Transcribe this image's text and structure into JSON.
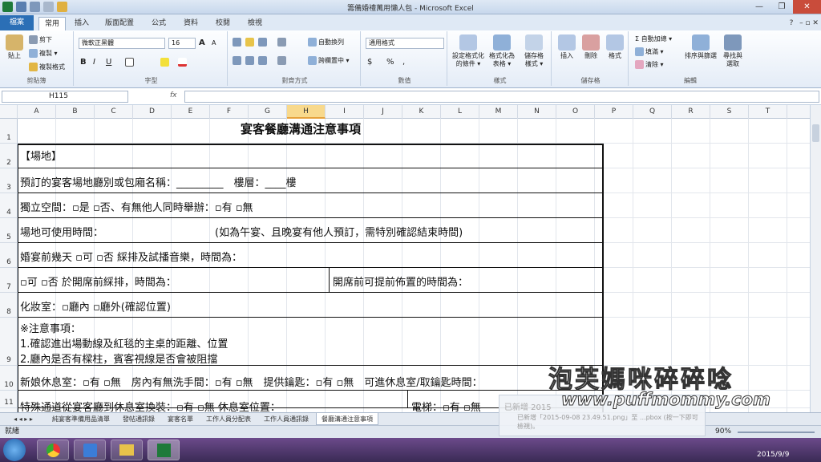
{
  "window": {
    "title": "籌備婚禮萬用懶人包 - Microsoft Excel"
  },
  "ribbon_tabs": {
    "file": "檔案",
    "home": "常用",
    "insert": "插入",
    "layout": "版面配置",
    "formulas": "公式",
    "data": "資料",
    "review": "校閱",
    "view": "檢視"
  },
  "clipboard": {
    "paste": "貼上",
    "cut": "剪下",
    "copy": "複製 ▾",
    "format_painter": "複製格式",
    "label": "剪貼簿"
  },
  "font": {
    "name": "微軟正黑體",
    "size": "16",
    "bold": "B",
    "italic": "I",
    "underline": "U",
    "grow": "A",
    "shrink": "A",
    "label": "字型"
  },
  "alignment": {
    "wrap": "自動換列",
    "merge": "跨欄置中 ▾",
    "label": "對齊方式"
  },
  "number": {
    "format": "通用格式",
    "currency": "$",
    "percent": "%",
    "comma": ",",
    "label": "數值"
  },
  "styles": {
    "conditional": "設定格式化\n的條件 ▾",
    "table": "格式化為\n表格 ▾",
    "cell": "儲存格\n樣式 ▾",
    "label": "樣式"
  },
  "cells": {
    "insert": "插入",
    "delete": "刪除",
    "format": "格式",
    "label": "儲存格"
  },
  "editing": {
    "autosum": "Σ 自動加總 ▾",
    "fill": "填滿 ▾",
    "clear": "清除 ▾",
    "sort": "排序與篩選",
    "find": "尋找與\n選取",
    "label": "編輯"
  },
  "formula_bar": {
    "name_box": "H115",
    "fx": "fx",
    "formula": ""
  },
  "columns": [
    "A",
    "B",
    "C",
    "D",
    "E",
    "F",
    "G",
    "H",
    "I",
    "J",
    "K",
    "L",
    "M",
    "N",
    "O",
    "P",
    "Q",
    "R",
    "S",
    "T"
  ],
  "rows": [
    "1",
    "2",
    "3",
    "4",
    "5",
    "6",
    "7",
    "8",
    "9",
    "10",
    "11"
  ],
  "selected_column": "H",
  "cells_text": {
    "title": "宴客餐廳溝通注意事項",
    "r2": "【場地】",
    "r3": "預訂的宴客場地廳別或包廂名稱：_________　樓層：____樓",
    "r4": "獨立空間：▫是 ▫否、有無他人同時舉辦：▫有 ▫無",
    "r5a": "場地可使用時間：",
    "r5b": "(如為午宴、且晚宴有他人預訂，需特別確認結束時間)",
    "r6": "婚宴前幾天 ▫可 ▫否 綵排及試播音樂，時間為：",
    "r7a": "▫可 ▫否 於開席前綵排，時間為：",
    "r7b": "開席前可提前佈置的時間為：",
    "r8": "化妝室：▫廳內 ▫廳外(確認位置)",
    "r9a": "※注意事項：",
    "r9b": "1.確認進出場動線及紅毯的主桌的距離、位置",
    "r9c": "2.廳內是否有樑柱，賓客視線是否會被阻擋",
    "r10": "新娘休息室：▫有 ▫無　房內有無洗手間：▫有 ▫無　提供鑰匙：▫有 ▫無　可進休息室/取鑰匙時間：",
    "r11a": "特殊通道從宴客廳到休息室換裝：▫有 ▫無 休息室位置：",
    "r11b": "電梯：▫有 ▫無"
  },
  "sheet_tabs": [
    "純宴客準備用品清單",
    "發帖通訊錄",
    "宴客名單",
    "工作人員分配表",
    "工作人員通訊錄",
    "餐廳溝通注意事項"
  ],
  "active_sheet": "餐廳溝通注意事項",
  "status": {
    "ready": "就緒",
    "zoom": "90%"
  },
  "toast": {
    "title": "已新增 2015",
    "body": "已新增「2015-09-08 23.49.51.png」至 ...pbox (按一下即可檢視)。"
  },
  "taskbar": {
    "date": "2015/9/9"
  },
  "watermark": {
    "title": "泡芙媽咪碎碎唸",
    "url": "www.puffmommy.com"
  }
}
